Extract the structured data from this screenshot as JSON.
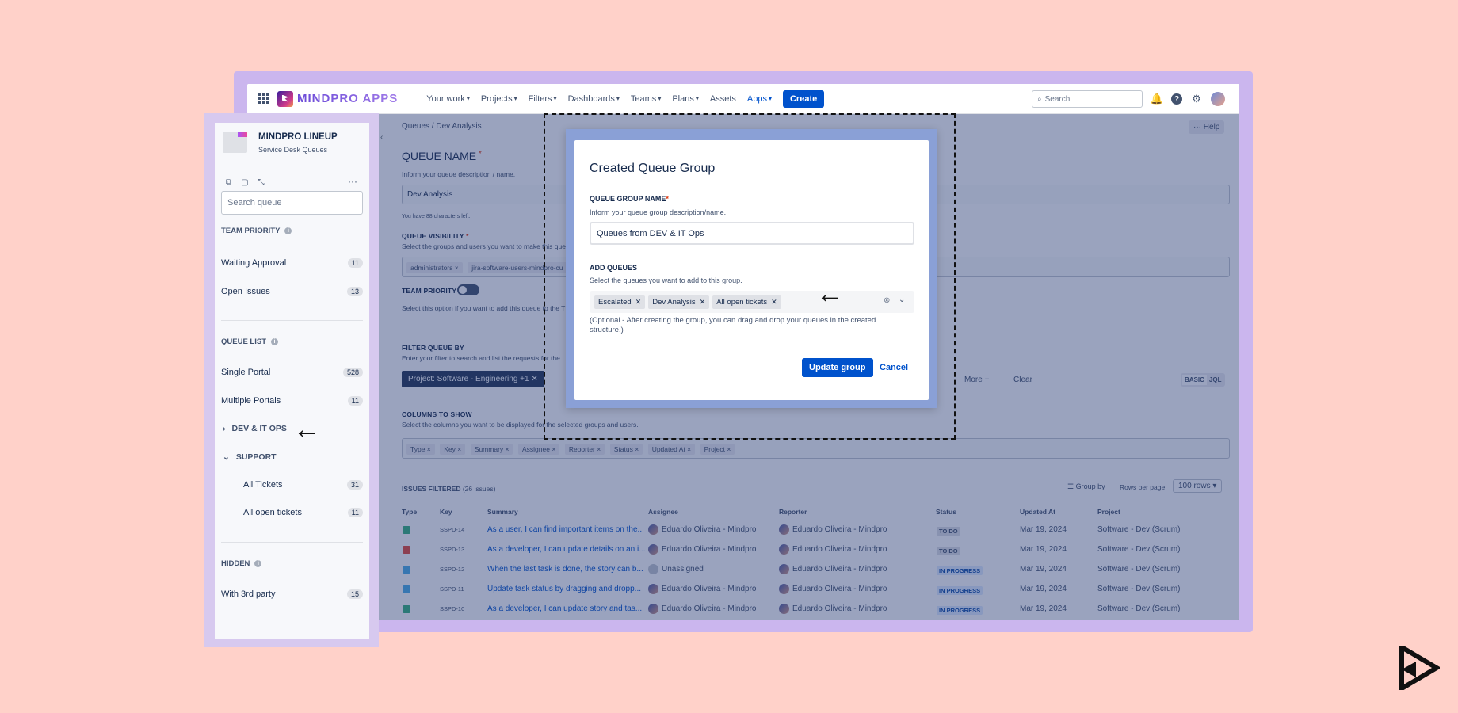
{
  "topnav": {
    "brand": "MINDPRO APPS",
    "items": [
      {
        "label": "Your work"
      },
      {
        "label": "Projects"
      },
      {
        "label": "Filters"
      },
      {
        "label": "Dashboards"
      },
      {
        "label": "Teams"
      },
      {
        "label": "Plans"
      },
      {
        "label": "Assets"
      },
      {
        "label": "Apps"
      }
    ],
    "create_label": "Create",
    "search_placeholder": "Search"
  },
  "page": {
    "breadcrumb": "Queues / Dev Analysis",
    "help_label": "Help",
    "queue_name_label": "QUEUE NAME",
    "queue_name_help": "Inform your queue description / name.",
    "queue_name_value": "Dev Analysis",
    "chars_left": "You have 88 characters left.",
    "visibility_label": "QUEUE VISIBILITY",
    "visibility_help": "Select the groups and users you want to make this queue",
    "visibility_chips": [
      "administrators",
      "jira-software-users-mindpro-cu"
    ],
    "team_priority_label": "TEAM PRIORITY",
    "team_priority_help": "Select this option if you want to add this queue to the T",
    "filter_label": "FILTER QUEUE BY",
    "filter_help": "Enter your filter to search and list the requests for the",
    "filter_chip": "Project: Software - Engineering +1",
    "more_label": "More",
    "clear_label": "Clear",
    "basic_label": "BASIC",
    "jql_label": "JQL",
    "columns_label": "COLUMNS TO SHOW",
    "columns_help": "Select the columns you want to be displayed for the selected groups and users.",
    "column_chips": [
      "Type",
      "Key",
      "Summary",
      "Assignee",
      "Reporter",
      "Status",
      "Updated At",
      "Project"
    ],
    "issues_filtered_label": "ISSUES FILTERED",
    "issues_count": "(26 issues)",
    "group_by_label": "Group by",
    "rows_per_page_label": "Rows per page",
    "rows_per_page_value": "100 rows",
    "table_headers": [
      "Type",
      "Key",
      "Summary",
      "Assignee",
      "Reporter",
      "Status",
      "Updated At",
      "Project"
    ],
    "rows": [
      {
        "type_color": "#36b37e",
        "key": "SSPD-14",
        "summary": "As a user, I can find important items on the...",
        "assignee": "Eduardo Oliveira - Mindpro",
        "reporter": "Eduardo Oliveira - Mindpro",
        "status": "TO DO",
        "updated": "Mar 19, 2024",
        "project": "Software - Dev (Scrum)"
      },
      {
        "type_color": "#e5493a",
        "key": "SSPD-13",
        "summary": "As a developer, I can update details on an i...",
        "assignee": "Eduardo Oliveira - Mindpro",
        "reporter": "Eduardo Oliveira - Mindpro",
        "status": "TO DO",
        "updated": "Mar 19, 2024",
        "project": "Software - Dev (Scrum)"
      },
      {
        "type_color": "#4bade8",
        "key": "SSPD-12",
        "summary": "When the last task is done, the story can b...",
        "assignee": "Unassigned",
        "reporter": "Eduardo Oliveira - Mindpro",
        "status": "IN PROGRESS",
        "updated": "Mar 19, 2024",
        "project": "Software - Dev (Scrum)"
      },
      {
        "type_color": "#4bade8",
        "key": "SSPD-11",
        "summary": "Update task status by dragging and dropp...",
        "assignee": "Eduardo Oliveira - Mindpro",
        "reporter": "Eduardo Oliveira - Mindpro",
        "status": "IN PROGRESS",
        "updated": "Mar 19, 2024",
        "project": "Software - Dev (Scrum)"
      },
      {
        "type_color": "#36b37e",
        "key": "SSPD-10",
        "summary": "As a developer, I can update story and tas...",
        "assignee": "Eduardo Oliveira - Mindpro",
        "reporter": "Eduardo Oliveira - Mindpro",
        "status": "IN PROGRESS",
        "updated": "Mar 19, 2024",
        "project": "Software - Dev (Scrum)"
      }
    ]
  },
  "modal": {
    "title": "Created Queue Group",
    "group_name_label": "QUEUE GROUP NAME",
    "group_name_help": "Inform your queue group description/name.",
    "group_name_value": "Queues from DEV & IT Ops",
    "add_queues_label": "ADD QUEUES",
    "add_queues_help": "Select the queues you want to add to this group.",
    "selected_queues": [
      "Escalated",
      "Dev Analysis",
      "All open tickets"
    ],
    "note": "(Optional - After creating the group, you can drag and drop your queues in the created structure.)",
    "update_button": "Update group",
    "cancel_button": "Cancel"
  },
  "sidebar": {
    "title": "MINDPRO LINEUP",
    "subtitle": "Service Desk Queues",
    "search_placeholder": "Search queue",
    "team_priority_heading": "TEAM PRIORITY",
    "team_priority_items": [
      {
        "label": "Waiting Approval",
        "count": "11"
      },
      {
        "label": "Open Issues",
        "count": "13"
      }
    ],
    "queue_list_heading": "QUEUE LIST",
    "queue_items": [
      {
        "label": "Single Portal",
        "count": "528"
      },
      {
        "label": "Multiple Portals",
        "count": "11"
      }
    ],
    "group_dev": "DEV & IT OPS",
    "group_support": "SUPPORT",
    "support_items": [
      {
        "label": "All Tickets",
        "count": "31"
      },
      {
        "label": "All open tickets",
        "count": "11"
      }
    ],
    "hidden_heading": "HIDDEN",
    "hidden_items": [
      {
        "label": "With 3rd party",
        "count": "15"
      }
    ]
  },
  "colors": {
    "background": "#ffd1c9",
    "primary": "#0052cc",
    "overlay": "rgba(30,50,110,0.45)"
  }
}
